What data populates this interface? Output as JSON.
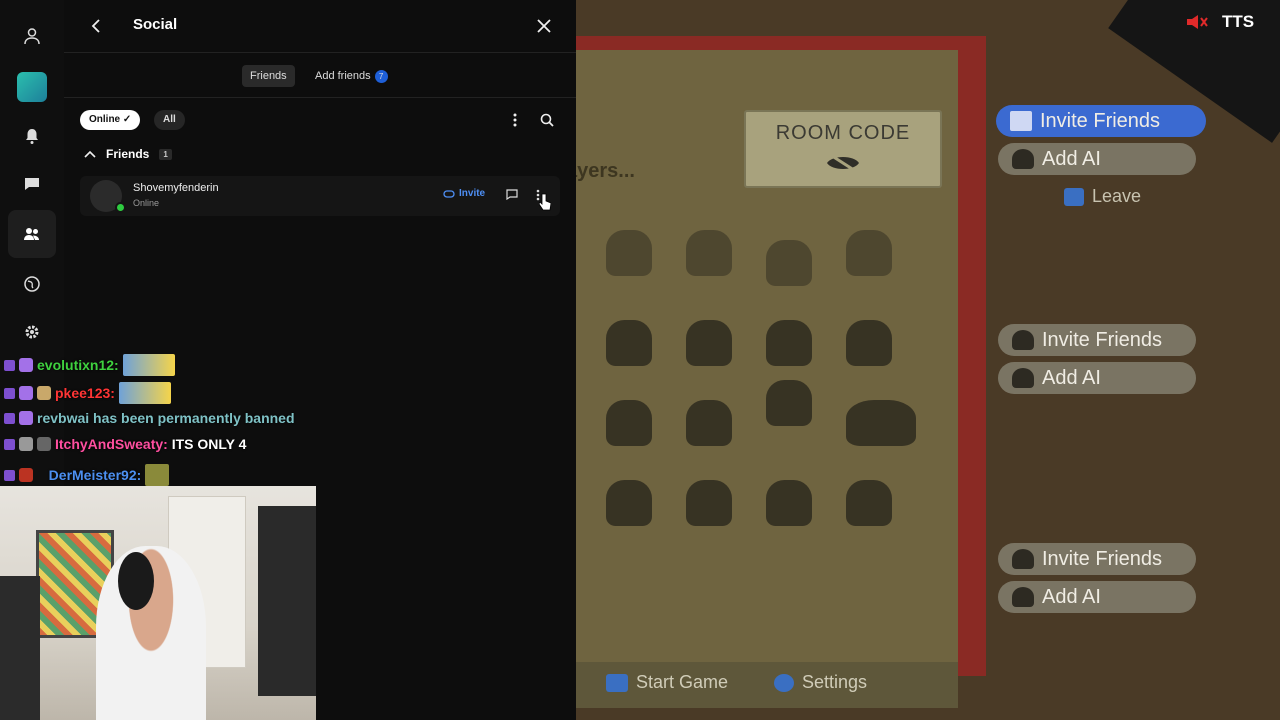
{
  "rail": {
    "items": [
      {
        "name": "profile-icon"
      },
      {
        "name": "game-icon"
      },
      {
        "name": "bell-icon"
      },
      {
        "name": "chat-icon"
      },
      {
        "name": "friends-icon"
      },
      {
        "name": "globe-icon"
      },
      {
        "name": "gear-icon"
      }
    ]
  },
  "panel": {
    "title": "Social",
    "tabs": [
      {
        "label": "Friends",
        "active": true
      },
      {
        "label": "Add friends",
        "badge": "7"
      }
    ],
    "filters": {
      "online": "Online",
      "all": "All"
    },
    "section": {
      "label": "Friends",
      "count": "1"
    },
    "friends": [
      {
        "name": "Shovemyfenderin",
        "status": "Online",
        "invite": "Invite"
      }
    ]
  },
  "chat": {
    "lines": [
      {
        "user": "evolutixn12:",
        "color": "#3fd13f",
        "msg": ""
      },
      {
        "user": "pkee123:",
        "color": "#ff3535",
        "msg": ""
      },
      {
        "user": "",
        "color": "#7fc2c6",
        "msg": "revbwai has been permanently banned"
      },
      {
        "user": "ItchyAndSweaty:",
        "color": "#ff4fa0",
        "msg": "ITS ONLY 4"
      },
      {
        "user": "DerMeister92:",
        "color": "#4c8ff0",
        "msg": ""
      }
    ]
  },
  "game": {
    "room_code": "ROOM CODE",
    "players": "ayers...",
    "start_game": "Start Game",
    "settings": "Settings",
    "invite_friends": "Invite Friends",
    "add_ai": "Add AI",
    "leave": "Leave",
    "tts": "TTS",
    "colors": {
      "primary_button": "#3b6ad1",
      "board_red": "#8a2a24"
    }
  }
}
